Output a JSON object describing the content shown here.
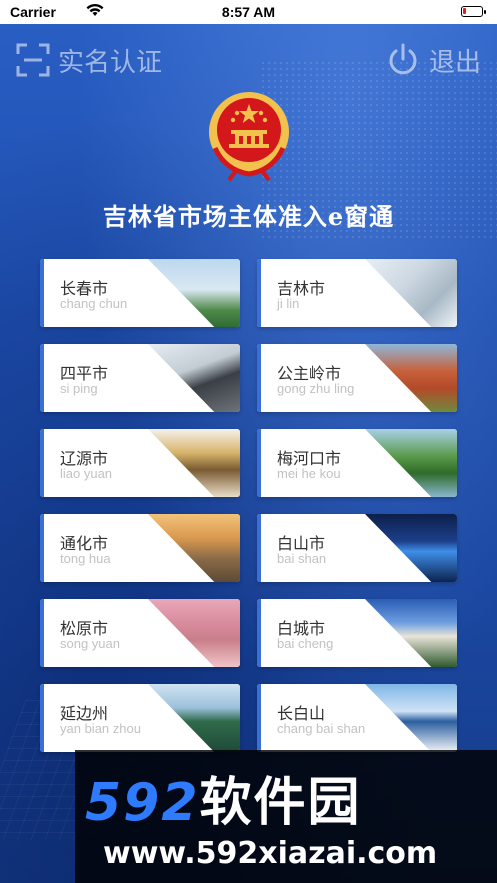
{
  "status_bar": {
    "carrier": "Carrier",
    "time": "8:57 AM"
  },
  "header": {
    "left_label": "实名认证",
    "left_icon": "scan-icon",
    "right_label": "退出",
    "right_icon": "power-icon"
  },
  "title": "吉林省市场主体准入e窗通",
  "cities": [
    {
      "name": "长春市",
      "pinyin": "chang chun"
    },
    {
      "name": "吉林市",
      "pinyin": "ji lin"
    },
    {
      "name": "四平市",
      "pinyin": "si ping"
    },
    {
      "name": "公主岭市",
      "pinyin": "gong zhu ling"
    },
    {
      "name": "辽源市",
      "pinyin": "liao yuan"
    },
    {
      "name": "梅河口市",
      "pinyin": "mei he kou"
    },
    {
      "name": "通化市",
      "pinyin": "tong hua"
    },
    {
      "name": "白山市",
      "pinyin": "bai shan"
    },
    {
      "name": "松原市",
      "pinyin": "song yuan"
    },
    {
      "name": "白城市",
      "pinyin": "bai cheng"
    },
    {
      "name": "延边州",
      "pinyin": "yan bian zhou"
    },
    {
      "name": "长白山",
      "pinyin": "chang bai shan"
    }
  ],
  "watermark": {
    "brand_number": "592",
    "brand_text": "软件园",
    "url": "www.592xiazai.com"
  },
  "colors": {
    "background": "#1f4fae",
    "card": "#ffffff",
    "accent_stripe": "#3b6fd8",
    "emblem_red": "#d4171a",
    "emblem_gold": "#f2c14e"
  }
}
